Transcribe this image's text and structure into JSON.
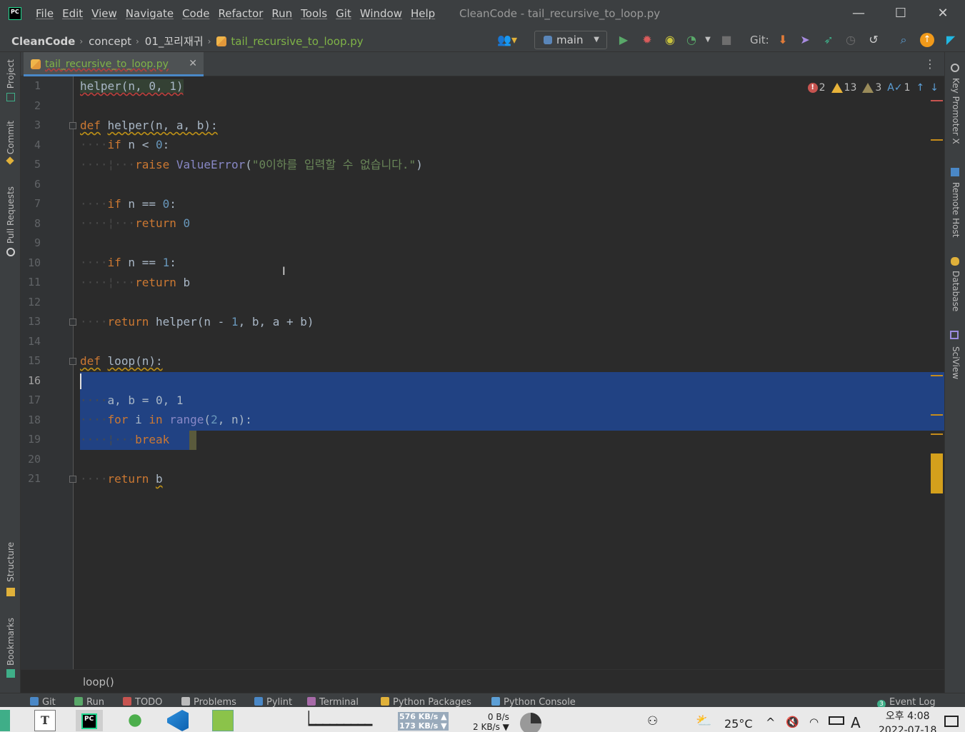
{
  "menu": [
    "File",
    "Edit",
    "View",
    "Navigate",
    "Code",
    "Refactor",
    "Run",
    "Tools",
    "Git",
    "Window",
    "Help"
  ],
  "window_title": "CleanCode - tail_recursive_to_loop.py",
  "breadcrumb": {
    "root": "CleanCode",
    "folder1": "concept",
    "folder2": "01_꼬리재귀",
    "file": "tail_recursive_to_loop.py"
  },
  "run_config": "main",
  "git_label": "Git:",
  "tab": {
    "label": "tail_recursive_to_loop.py"
  },
  "inspections": {
    "errors": "2",
    "warnings": "13",
    "weak_warnings": "3",
    "typos": "1"
  },
  "line_numbers": [
    "1",
    "2",
    "3",
    "4",
    "5",
    "6",
    "7",
    "8",
    "9",
    "10",
    "11",
    "12",
    "13",
    "14",
    "15",
    "16",
    "17",
    "18",
    "19",
    "20",
    "21"
  ],
  "current_line": "16",
  "code": {
    "l1": "helper(n, 0, 1)",
    "l5_str": "\"0이하를 입력할 수 없습니다.\"",
    "l17": "a, b = 0, 1"
  },
  "editor_footer": "loop()",
  "left_tools": [
    "Project",
    "Commit",
    "Pull Requests",
    "Structure",
    "Bookmarks"
  ],
  "right_tools": [
    "Key Promoter X",
    "Remote Host",
    "Database",
    "SciView"
  ],
  "bottom_tools": [
    "Git",
    "Run",
    "TODO",
    "Problems",
    "Pylint",
    "Terminal",
    "Python Packages",
    "Python Console"
  ],
  "event_log": {
    "count": "3",
    "label": "Event Log"
  },
  "taskbar": {
    "net_up": "576 KB/s",
    "net_down": "173 KB/s",
    "disk_r": "0 B/s",
    "disk_w": "2 KB/s",
    "temp": "25°C",
    "ime": "A",
    "time": "오후 4:08",
    "date": "2022-07-18"
  },
  "colors": {
    "keyword": "#cc7832",
    "number": "#6897bb",
    "string": "#6a8759",
    "builtin": "#8888c6",
    "selection": "#214283",
    "accent": "#4a88c7"
  }
}
